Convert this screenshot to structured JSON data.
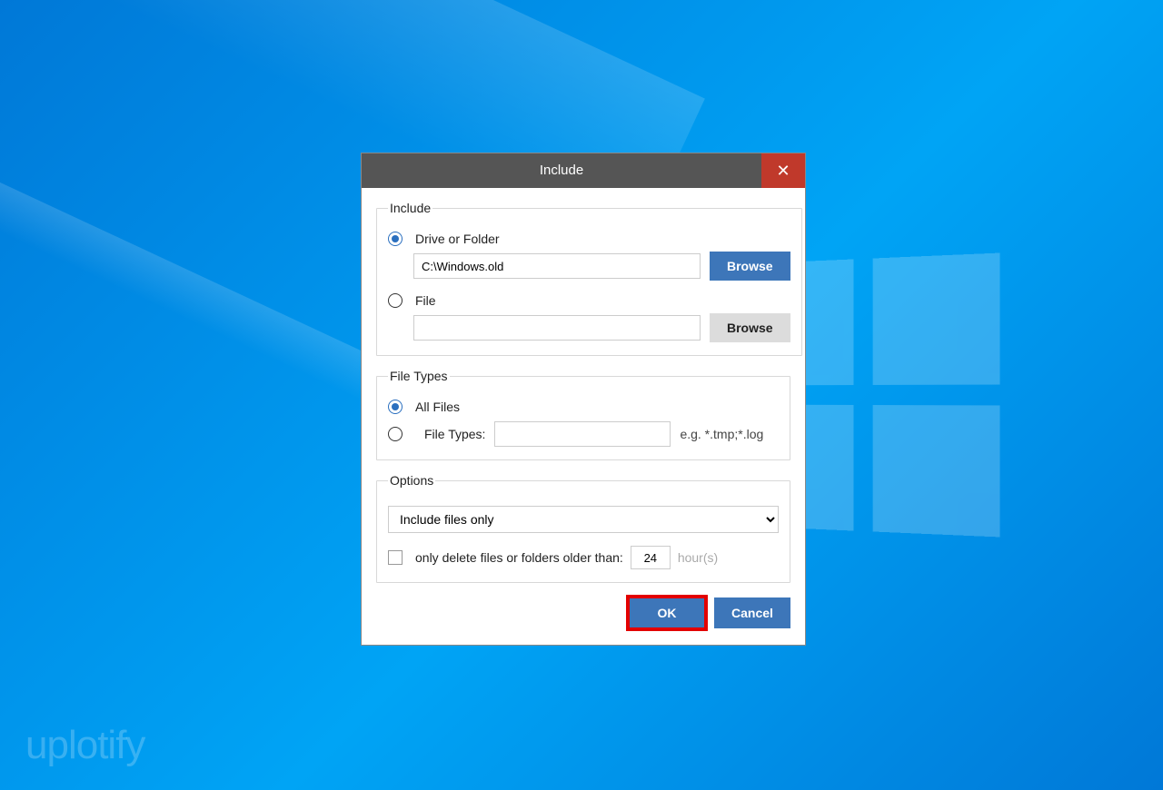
{
  "watermark": "uplotify",
  "dialog": {
    "title": "Include",
    "close": "✕",
    "include": {
      "legend": "Include",
      "driveOrFolder": {
        "label": "Drive or Folder",
        "value": "C:\\Windows.old",
        "browse": "Browse",
        "selected": true
      },
      "file": {
        "label": "File",
        "value": "",
        "browse": "Browse",
        "selected": false
      }
    },
    "fileTypes": {
      "legend": "File Types",
      "allFiles": {
        "label": "All Files",
        "selected": true
      },
      "fileTypes": {
        "label": "File Types:",
        "value": "",
        "hint": "e.g. *.tmp;*.log",
        "selected": false
      }
    },
    "options": {
      "legend": "Options",
      "select": "Include files only",
      "onlyDelete": {
        "checked": false,
        "label": "only delete files or folders older than:",
        "value": "24",
        "unit": "hour(s)"
      }
    },
    "ok": "OK",
    "cancel": "Cancel"
  }
}
